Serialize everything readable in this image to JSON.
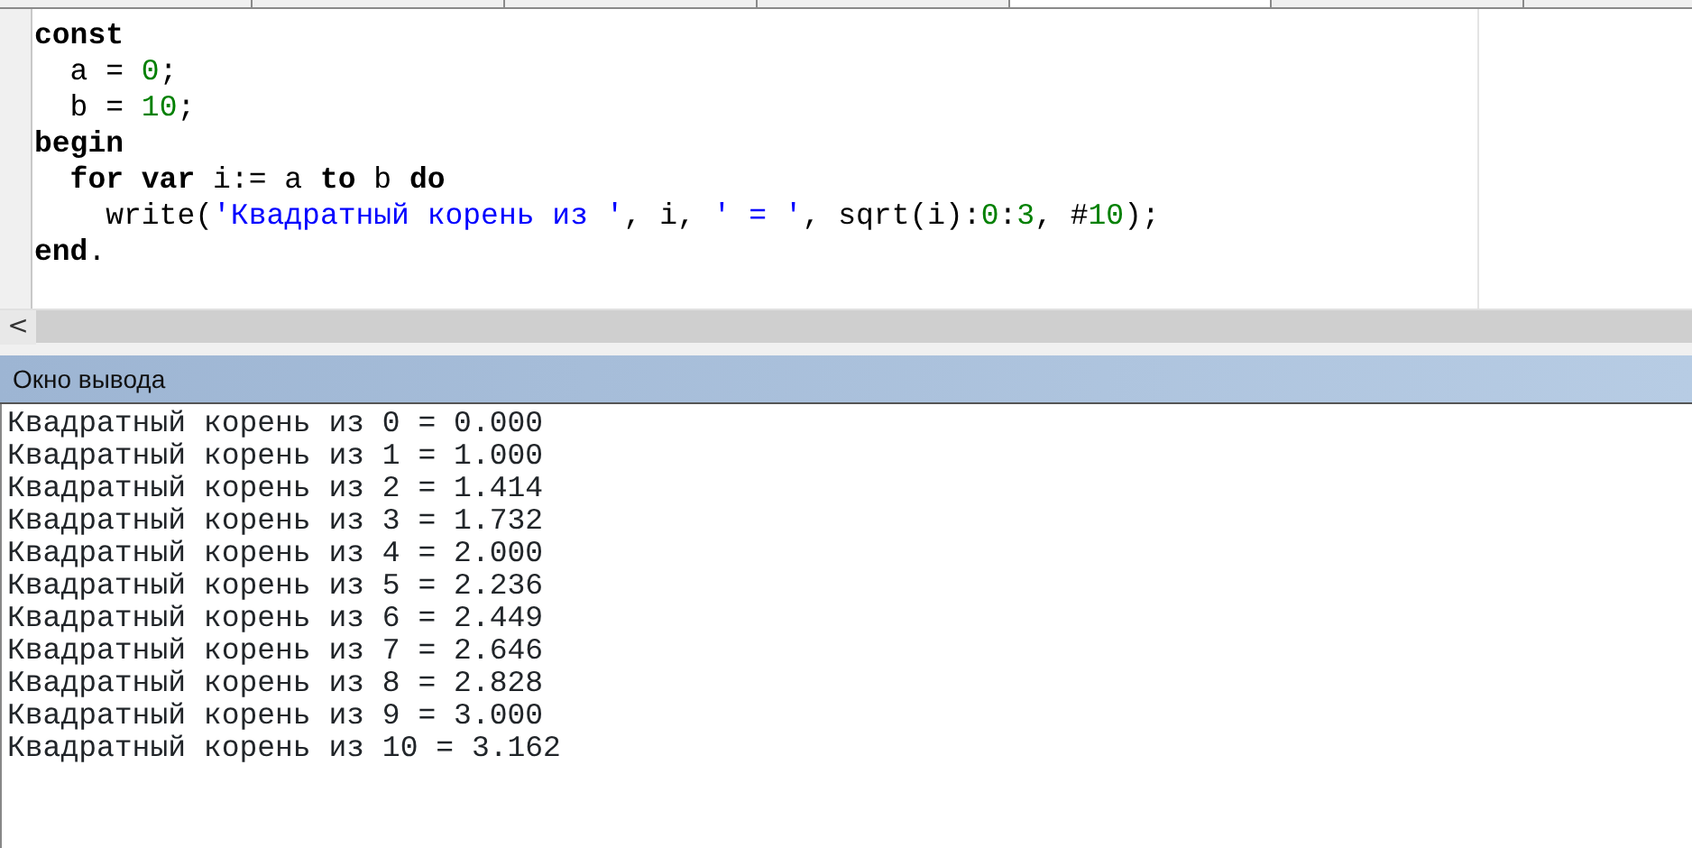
{
  "editor": {
    "lines": [
      [
        {
          "kind": "keyword",
          "text": "const"
        }
      ],
      [
        {
          "kind": "plain",
          "text": "  a = "
        },
        {
          "kind": "number",
          "text": "0"
        },
        {
          "kind": "plain",
          "text": ";"
        }
      ],
      [
        {
          "kind": "plain",
          "text": "  b = "
        },
        {
          "kind": "number",
          "text": "10"
        },
        {
          "kind": "plain",
          "text": ";"
        }
      ],
      [
        {
          "kind": "keyword",
          "text": "begin"
        }
      ],
      [
        {
          "kind": "keyword",
          "text": "  for var"
        },
        {
          "kind": "plain",
          "text": " i:= a "
        },
        {
          "kind": "keyword",
          "text": "to"
        },
        {
          "kind": "plain",
          "text": " b "
        },
        {
          "kind": "keyword",
          "text": "do"
        }
      ],
      [
        {
          "kind": "plain",
          "text": "    write("
        },
        {
          "kind": "string",
          "text": "'Квадратный корень из '"
        },
        {
          "kind": "plain",
          "text": ", i, "
        },
        {
          "kind": "string",
          "text": "' = '"
        },
        {
          "kind": "plain",
          "text": ", sqrt(i):"
        },
        {
          "kind": "number",
          "text": "0"
        },
        {
          "kind": "plain",
          "text": ":"
        },
        {
          "kind": "number",
          "text": "3"
        },
        {
          "kind": "plain",
          "text": ", #"
        },
        {
          "kind": "number",
          "text": "10"
        },
        {
          "kind": "plain",
          "text": ");"
        }
      ],
      [
        {
          "kind": "keyword",
          "text": "end"
        },
        {
          "kind": "plain",
          "text": "."
        }
      ]
    ],
    "scroll_left": "<"
  },
  "output": {
    "title": "Окно вывода",
    "lines": [
      "Квадратный корень из 0 = 0.000",
      "Квадратный корень из 1 = 1.000",
      "Квадратный корень из 2 = 1.414",
      "Квадратный корень из 3 = 1.732",
      "Квадратный корень из 4 = 2.000",
      "Квадратный корень из 5 = 2.236",
      "Квадратный корень из 6 = 2.449",
      "Квадратный корень из 7 = 2.646",
      "Квадратный корень из 8 = 2.828",
      "Квадратный корень из 9 = 3.000",
      "Квадратный корень из 10 = 3.162"
    ]
  }
}
